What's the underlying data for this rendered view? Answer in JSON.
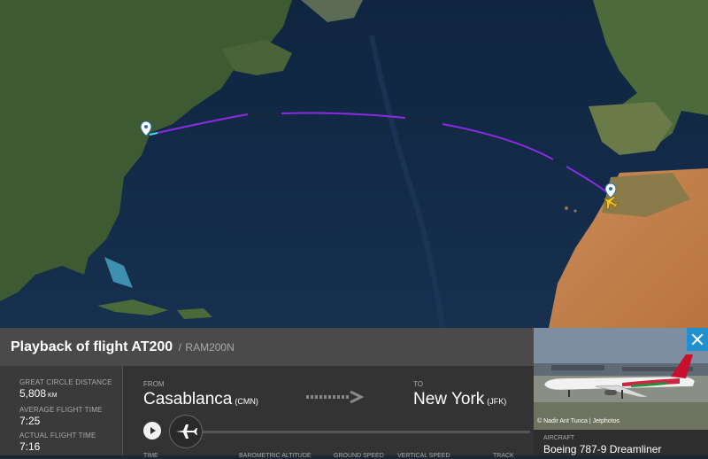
{
  "map": {
    "route_color": "#8a2be2",
    "origin_marker": "pin-icon",
    "destination_marker": "pin-icon",
    "plane_icon": "airplane-icon"
  },
  "flight": {
    "title": "Playback of flight AT200",
    "callsign": "RAM200N"
  },
  "stats": {
    "distance_label": "GREAT CIRCLE DISTANCE",
    "distance_value": "5,808",
    "distance_unit": "KM",
    "avg_time_label": "AVERAGE FLIGHT TIME",
    "avg_time_value": "7:25",
    "actual_time_label": "ACTUAL FLIGHT TIME",
    "actual_time_value": "7:16"
  },
  "route": {
    "from_label": "FROM",
    "from_city": "Casablanca",
    "from_code": "(CMN)",
    "to_label": "TO",
    "to_city": "New York",
    "to_code": "(JFK)"
  },
  "playback": {
    "progress": 0.0,
    "columns": [
      "TIME",
      "BAROMETRIC ALTITUDE",
      "GROUND SPEED",
      "VERTICAL SPEED",
      "TRACK"
    ]
  },
  "aircraft": {
    "photo_credit": "© Nadir Ant Tunca | Jetphotos",
    "label": "AIRCRAFT",
    "model": "Boeing 787-9 Dreamliner"
  },
  "colors": {
    "accent": "#2190d0",
    "panel": "#3a3a3a"
  }
}
